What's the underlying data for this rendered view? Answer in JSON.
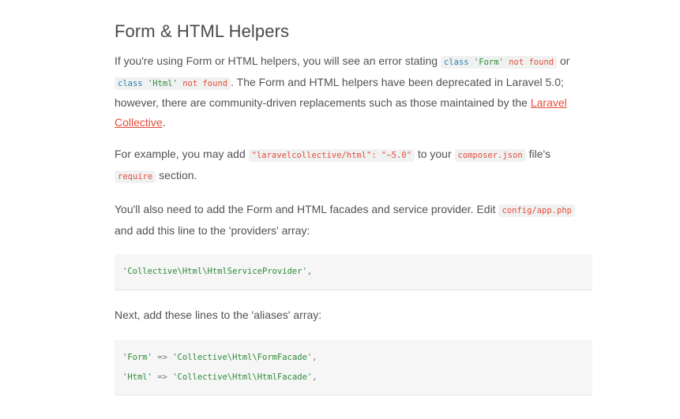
{
  "heading": "Form & HTML Helpers",
  "para1": {
    "t1": "If you're using Form or HTML helpers, you will see an error stating ",
    "code1_kw": "class",
    "code1_str": "'Form'",
    "code1_err": "not found",
    "t2": " or",
    "code2_kw": "class",
    "code2_str": "'Html'",
    "code2_err": "not found",
    "t3": ". The Form and HTML helpers have been deprecated in Laravel 5.0; however, there are community-driven replacements such as those maintained by the ",
    "link": "Laravel Collective",
    "t4": "."
  },
  "para2": {
    "t1": "For example, you may add ",
    "code1": "\"laravelcollective/html\": \"~5.0\"",
    "t2": " to your ",
    "code2": "composer.json",
    "t3": " file's",
    "code3": "require",
    "t4": " section."
  },
  "para3": {
    "t1": "You'll also need to add the Form and HTML facades and service provider. Edit ",
    "code1": "config/app.php",
    "t2": " and add this line to the 'providers' array:"
  },
  "block1": {
    "line1": "'Collective\\Html\\HtmlServiceProvider',"
  },
  "para4": "Next, add these lines to the 'aliases' array:",
  "block2": {
    "l1_key": "'Form'",
    "l1_op": " => ",
    "l1_val": "'Collective\\Html\\FormFacade'",
    "l1_end": ",",
    "l2_key": "'Html'",
    "l2_op": " => ",
    "l2_val": "'Collective\\Html\\HtmlFacade'",
    "l2_end": ","
  },
  "colors": {
    "text": "#525252",
    "link": "#e74c3c",
    "code_keyword": "#2980b9",
    "code_string": "#2e8b3a",
    "code_bg": "#f0f2f1"
  }
}
